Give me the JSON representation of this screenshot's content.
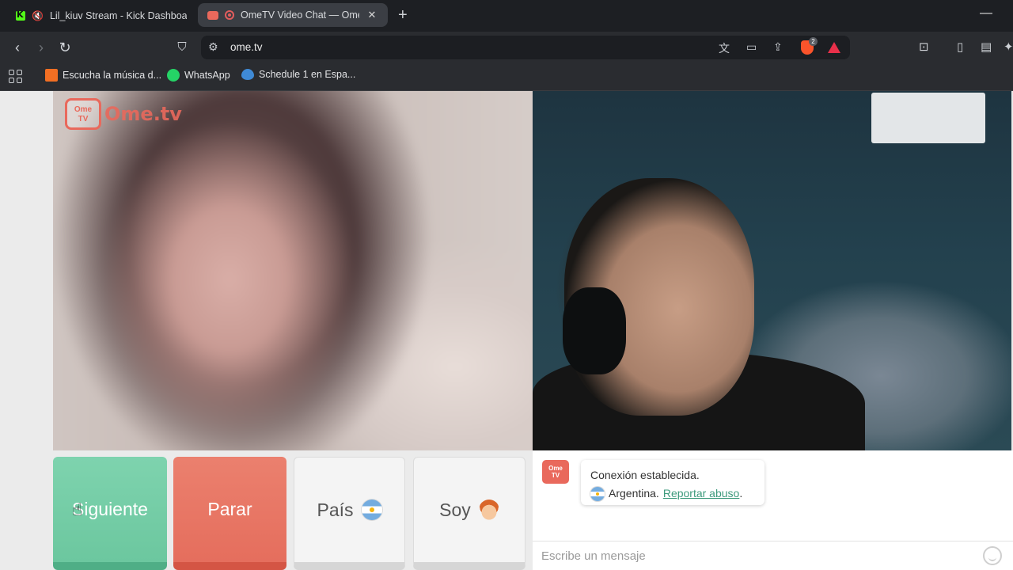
{
  "browser": {
    "tabs": [
      {
        "title": "Lil_kiuv Stream - Kick Dashboard",
        "active": false,
        "muted": true
      },
      {
        "title": "OmeTV Video Chat — Omegl",
        "active": true,
        "recording": true
      }
    ],
    "url": "ome.tv",
    "bookmarks": [
      {
        "label": "Escucha la música d...",
        "icon": "soundcloud-icon"
      },
      {
        "label": "WhatsApp",
        "icon": "whatsapp-icon"
      },
      {
        "label": "Schedule 1 en Espa...",
        "icon": "schedule1-icon"
      }
    ],
    "shield_badge": "2"
  },
  "logo": {
    "badge": "Ome\nTV",
    "text": "Ome.tv"
  },
  "controls": {
    "next": "Siguiente",
    "stop": "Parar",
    "country": "País",
    "soy": "Soy"
  },
  "chat": {
    "status": "Conexión establecida.",
    "country": "Argentina.",
    "report": "Reportar abuso",
    "report_suffix": ".",
    "placeholder": "Escribe un mensaje"
  },
  "colors": {
    "next": "#6cc79f",
    "stop": "#e56e5d",
    "accent": "#e9695c",
    "link": "#3d9a7c"
  }
}
